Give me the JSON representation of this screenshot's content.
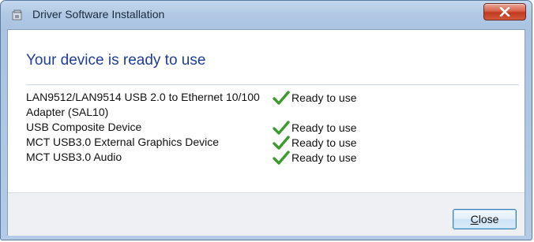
{
  "window": {
    "title": "Driver Software Installation",
    "close_glyph": "x"
  },
  "heading": "Your device is ready to use",
  "devices": [
    {
      "name": "LAN9512/LAN9514 USB 2.0 to Ethernet 10/100 Adapter (SAL10)",
      "status": "Ready to use",
      "status_icon": "check-icon"
    },
    {
      "name": "USB Composite Device",
      "status": "Ready to use",
      "status_icon": "check-icon"
    },
    {
      "name": "MCT USB3.0 External Graphics Device",
      "status": "Ready to use",
      "status_icon": "check-icon"
    },
    {
      "name": "MCT USB3.0 Audio",
      "status": "Ready to use",
      "status_icon": "check-icon"
    }
  ],
  "footer": {
    "close_mnemonic": "C",
    "close_rest": "lose"
  },
  "colors": {
    "heading": "#1f3d9a",
    "check": "#3c9a2e",
    "close_button_red": "#c2391f"
  }
}
